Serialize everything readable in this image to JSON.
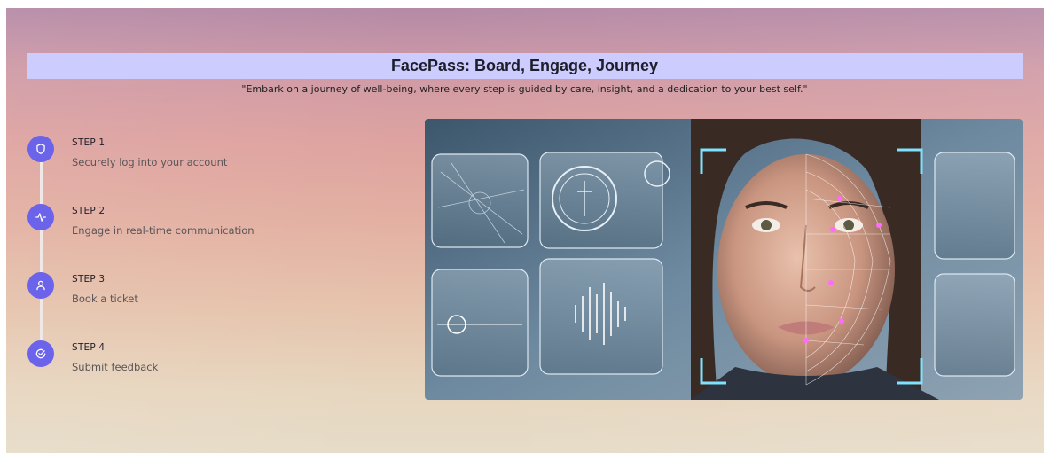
{
  "header": {
    "title": "FacePass: Board, Engage, Journey",
    "tagline": "\"Embark on a journey of well-being, where every step is guided by care, insight, and a dedication to your best self.\""
  },
  "steps": [
    {
      "label": "STEP 1",
      "description": "Securely log into your account",
      "icon": "shield-icon"
    },
    {
      "label": "STEP 2",
      "description": "Engage in real-time communication",
      "icon": "activity-icon"
    },
    {
      "label": "STEP 3",
      "description": "Book a ticket",
      "icon": "user-icon"
    },
    {
      "label": "STEP 4",
      "description": "Submit feedback",
      "icon": "check-circle-icon"
    }
  ],
  "hero_image": {
    "subject": "facial-recognition-illustration"
  },
  "colors": {
    "accent": "#6b63ea",
    "title_bar": "#ccccff",
    "frame": "#cccccc"
  }
}
